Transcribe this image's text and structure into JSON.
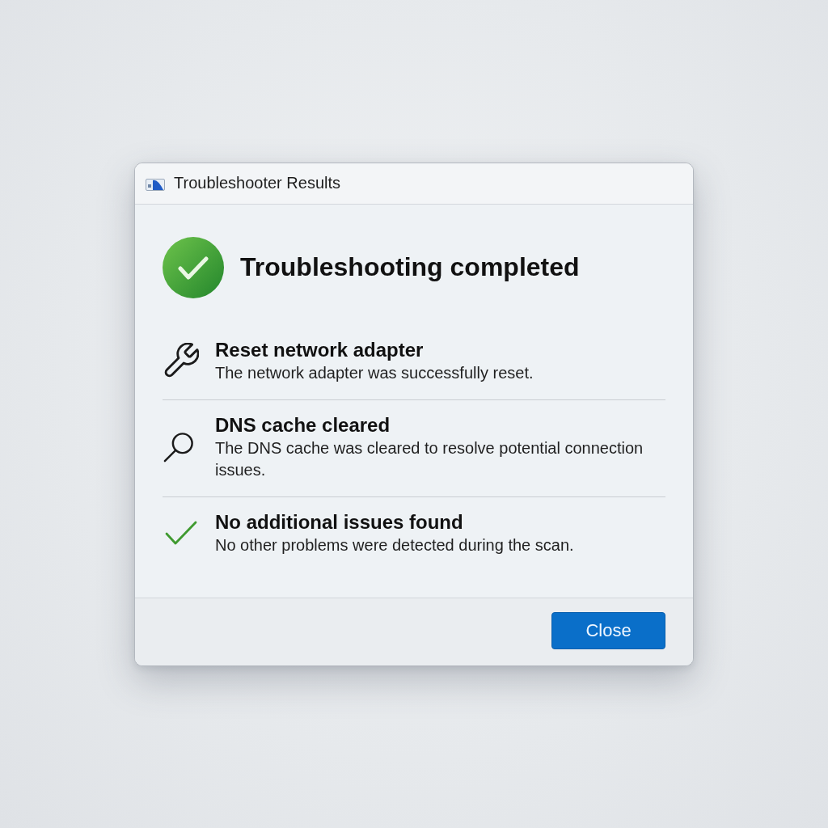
{
  "window": {
    "title": "Troubleshooter Results"
  },
  "header": {
    "success": true,
    "title": "Troubleshooting completed"
  },
  "items": [
    {
      "kind": "repair",
      "title": "Reset network adapter",
      "description": "The network adapter was successfully reset."
    },
    {
      "kind": "lookup",
      "title": "DNS cache cleared",
      "description": "The DNS cache was cleared to resolve potential connection issues."
    },
    {
      "kind": "pass",
      "title": "No additional issues found",
      "description": "No other problems were detected during the scan."
    }
  ],
  "buttons": [
    {
      "label": "Close",
      "primary": true
    }
  ]
}
